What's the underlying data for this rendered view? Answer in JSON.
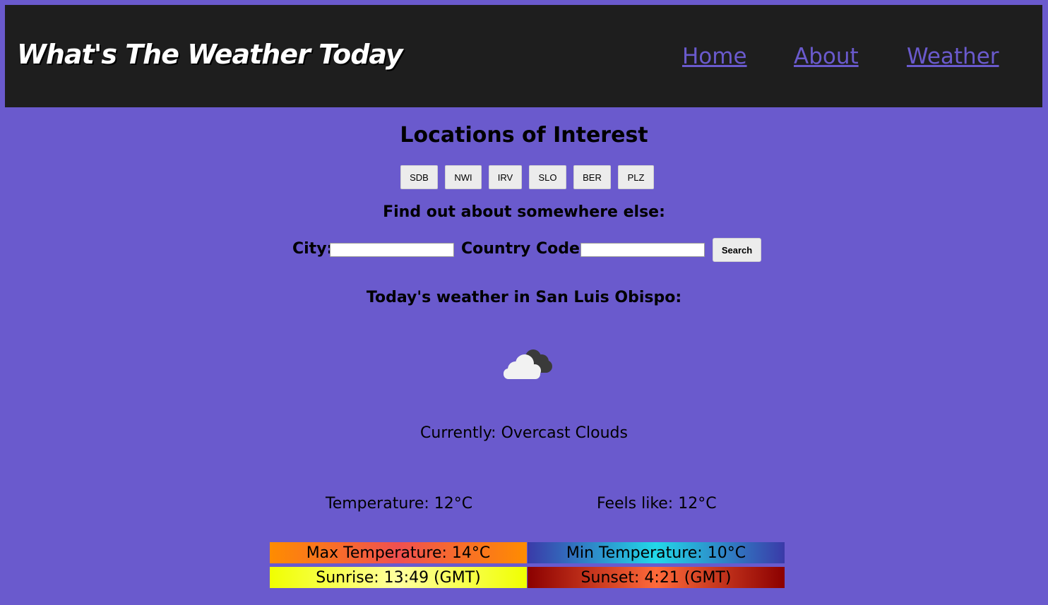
{
  "header": {
    "site_title": "What's The Weather Today",
    "nav": [
      "Home",
      "About",
      "Weather"
    ]
  },
  "locations": {
    "heading": "Locations of Interest",
    "buttons": [
      "SDB",
      "NWI",
      "IRV",
      "SLO",
      "BER",
      "PLZ"
    ]
  },
  "search": {
    "heading": "Find out about somewhere else:",
    "city_label": "City:",
    "city_value": "",
    "country_label": "Country Code:",
    "country_value": "",
    "button_label": "Search"
  },
  "weather": {
    "heading": "Today's weather in San Luis Obispo:",
    "icon": "overcast-clouds-icon",
    "currently": "Currently: Overcast Clouds",
    "temperature": "Temperature: 12°C",
    "feels_like": "Feels like: 12°C",
    "max_temp": "Max Temperature: 14°C",
    "min_temp": "Min Temperature: 10°C",
    "sunrise": "Sunrise: 13:49 (GMT)",
    "sunset": "Sunset: 4:21 (GMT)"
  },
  "colors": {
    "background": "#6a5acd",
    "header": "#1e1e1e",
    "link": "#6a5acd"
  }
}
